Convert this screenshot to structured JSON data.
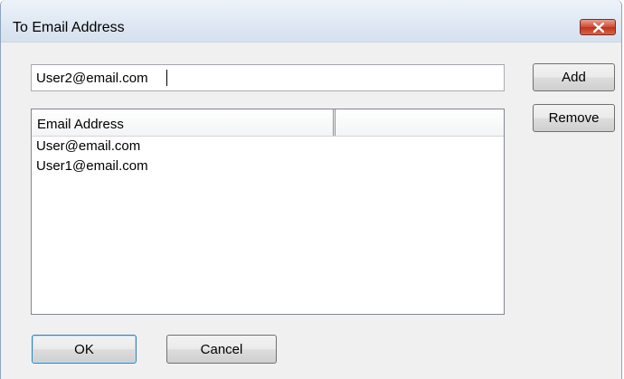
{
  "window": {
    "title": "To Email Address"
  },
  "email_input": {
    "value": "User2@email.com"
  },
  "buttons": {
    "add": "Add",
    "remove": "Remove",
    "ok": "OK",
    "cancel": "Cancel"
  },
  "list": {
    "columns": [
      "Email Address",
      ""
    ],
    "rows": [
      "User@email.com",
      "User1@email.com"
    ]
  },
  "icons": {
    "close": "close-x-icon"
  }
}
